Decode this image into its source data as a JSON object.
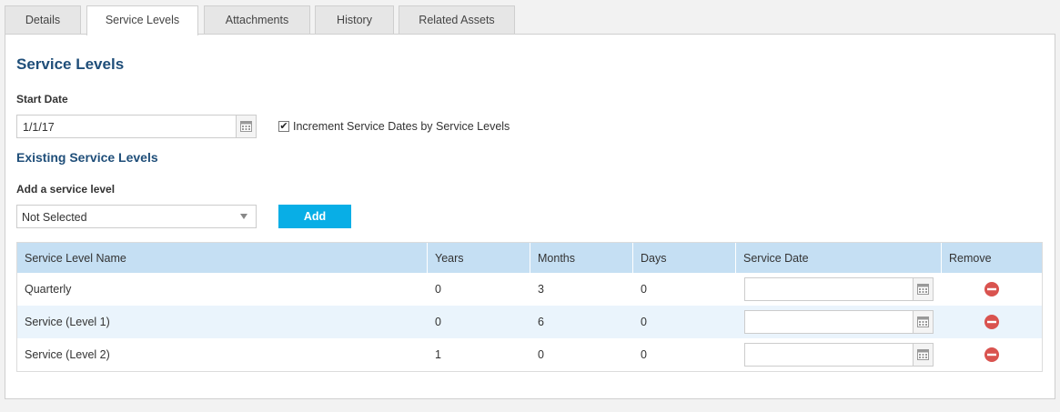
{
  "tabs": [
    {
      "label": "Details",
      "active": false
    },
    {
      "label": "Service Levels",
      "active": true
    },
    {
      "label": "Attachments",
      "active": false
    },
    {
      "label": "History",
      "active": false
    },
    {
      "label": "Related Assets",
      "active": false
    }
  ],
  "page": {
    "title": "Service Levels",
    "start_date_label": "Start Date",
    "start_date_value": "1/1/17",
    "increment_checked": true,
    "increment_label": "Increment Service Dates by Service Levels",
    "existing_title": "Existing Service Levels",
    "add_label": "Add a service level",
    "select_value": "Not Selected",
    "add_button": "Add"
  },
  "table": {
    "headers": [
      "Service Level Name",
      "Years",
      "Months",
      "Days",
      "Service Date",
      "Remove"
    ],
    "rows": [
      {
        "name": "Quarterly",
        "years": "0",
        "months": "3",
        "days": "0",
        "service_date": ""
      },
      {
        "name": "Service (Level 1)",
        "years": "0",
        "months": "6",
        "days": "0",
        "service_date": ""
      },
      {
        "name": "Service (Level 2)",
        "years": "1",
        "months": "0",
        "days": "0",
        "service_date": ""
      }
    ]
  },
  "icons": {
    "calendar": "calendar-icon",
    "remove": "remove-icon",
    "dropdown": "chevron-down-icon",
    "checkbox": "checkmark-icon"
  },
  "colors": {
    "heading": "#1f4e79",
    "accent_button": "#08aee6",
    "table_header": "#c5dff3",
    "row_alt": "#eaf4fc",
    "remove_red": "#d9534f"
  }
}
